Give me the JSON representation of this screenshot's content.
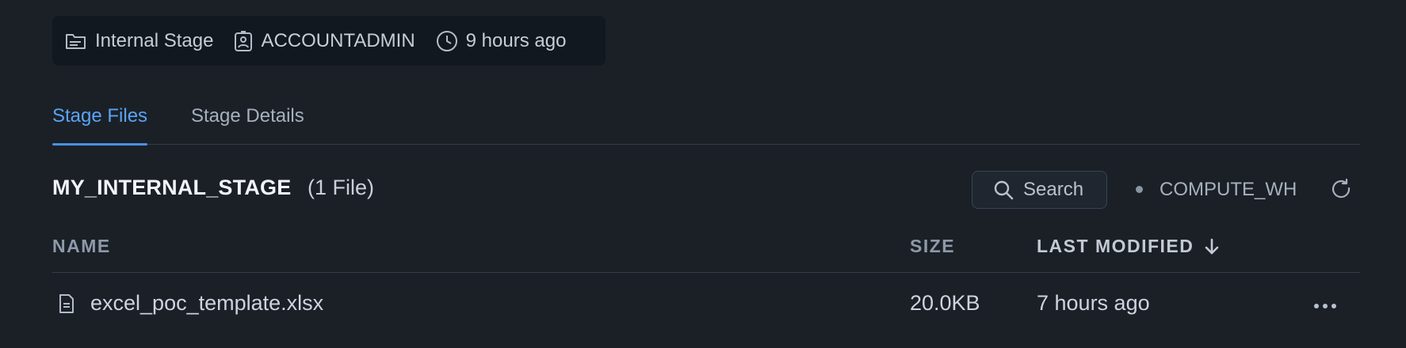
{
  "meta": {
    "stage_type": "Internal Stage",
    "owner": "ACCOUNTADMIN",
    "created": "9 hours ago"
  },
  "tabs": [
    {
      "label": "Stage Files",
      "active": true
    },
    {
      "label": "Stage Details",
      "active": false
    }
  ],
  "stage": {
    "name": "MY_INTERNAL_STAGE",
    "file_count": "(1 File)"
  },
  "toolbar": {
    "search_label": "Search",
    "warehouse": "COMPUTE_WH"
  },
  "table": {
    "columns": {
      "name": "NAME",
      "size": "SIZE",
      "modified": "LAST MODIFIED"
    },
    "sort": {
      "column": "modified",
      "direction": "desc"
    },
    "rows": [
      {
        "name": "excel_poc_template.xlsx",
        "size": "20.0KB",
        "modified": "7 hours ago"
      }
    ]
  },
  "icons": {
    "stage": "stage-folder-icon",
    "owner": "user-badge-icon",
    "time": "clock-icon",
    "search": "search-icon",
    "refresh": "refresh-icon",
    "sort": "arrow-down-icon",
    "file": "document-icon",
    "more": "more-horizontal-icon"
  },
  "colors": {
    "background": "#1b2027",
    "accent": "#5aa3f5"
  }
}
